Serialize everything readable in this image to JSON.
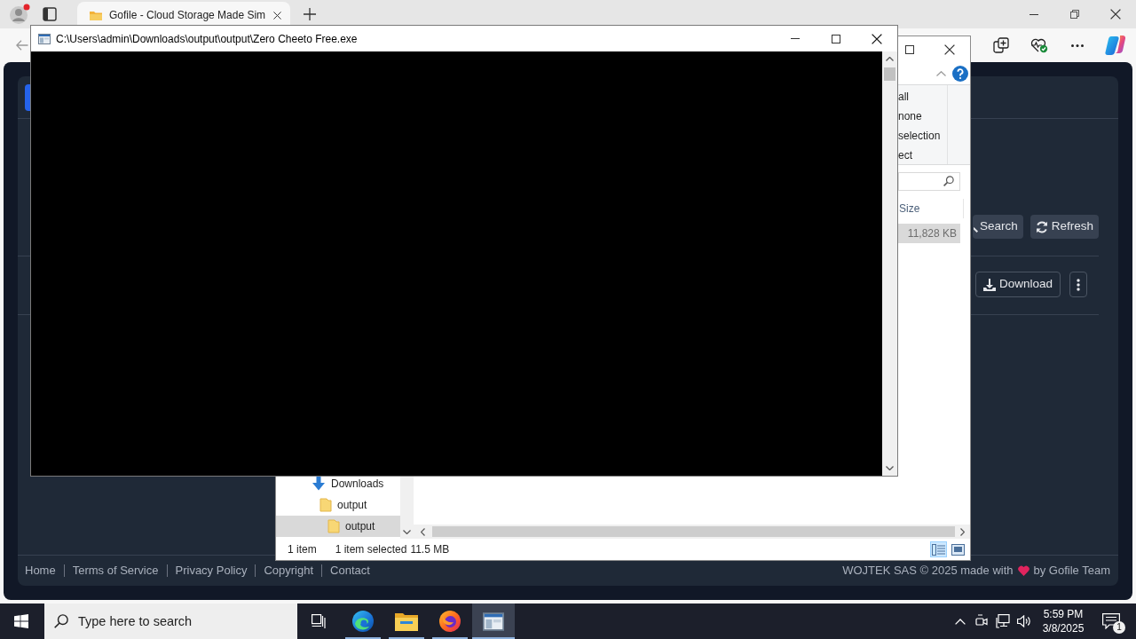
{
  "browser": {
    "tabs": [
      {
        "title": "Gofile - Cloud Storage Made Sim",
        "selected": true
      }
    ]
  },
  "gofile": {
    "toolbar_buttons": [
      {
        "label": "Search",
        "kind": "search"
      },
      {
        "label": "Refresh",
        "kind": "refresh"
      }
    ],
    "file_actions": [
      {
        "label": "Download"
      }
    ],
    "footer": {
      "links": [
        "Home",
        "Terms of Service",
        "Privacy Policy",
        "Copyright",
        "Contact"
      ],
      "credit_before": "WOJTEK SAS © 2025 made with",
      "credit_after": "by Gofile Team"
    }
  },
  "explorer": {
    "ribbon_select_group": {
      "commands": [
        "all",
        "none",
        "selection"
      ],
      "label": "ect"
    },
    "columns": [
      {
        "label": "Size"
      }
    ],
    "rows": [
      {
        "size": "11,828 KB",
        "selected": true
      }
    ],
    "navigation": [
      {
        "label": "Downloads",
        "kind": "downloads",
        "selected": false,
        "children": [
          {
            "label": "output",
            "kind": "folder",
            "selected": false,
            "children": [
              {
                "label": "output",
                "kind": "folder",
                "selected": true
              }
            ]
          }
        ]
      }
    ],
    "status_bar": {
      "item_count": "1 item",
      "selection": "1 item selected",
      "selection_size": "11.5 MB"
    },
    "views": [
      {
        "kind": "details",
        "selected": true
      },
      {
        "kind": "large-icons",
        "selected": false
      }
    ]
  },
  "console": {
    "title": "C:\\Users\\admin\\Downloads\\output\\output\\Zero Cheeto Free.exe"
  },
  "taskbar": {
    "search": {
      "placeholder": "Type here to search"
    },
    "apps": [
      {
        "kind": "task-view",
        "running": false,
        "active": false
      },
      {
        "kind": "edge",
        "running": true,
        "active": false
      },
      {
        "kind": "file-explorer",
        "running": true,
        "active": false
      },
      {
        "kind": "firefox",
        "running": true,
        "active": false
      },
      {
        "kind": "console",
        "running": true,
        "active": true
      }
    ],
    "clock": {
      "time": "5:59 PM",
      "date": "3/8/2025"
    },
    "notifications": {
      "count": "1"
    }
  }
}
